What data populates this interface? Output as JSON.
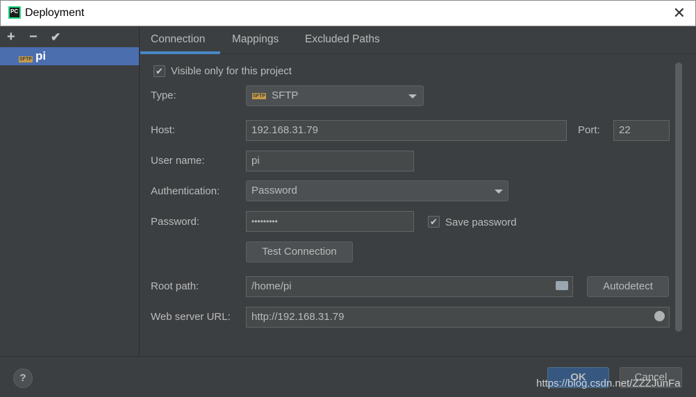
{
  "window": {
    "title": "Deployment",
    "app_icon_text": "PC"
  },
  "left_panel": {
    "toolbar": {
      "add": "+",
      "remove": "−",
      "apply": "✔"
    },
    "servers": [
      {
        "name": "pi",
        "type_badge": "SFTP",
        "selected": true
      }
    ]
  },
  "tabs": [
    {
      "label": "Connection",
      "active": true
    },
    {
      "label": "Mappings"
    },
    {
      "label": "Excluded Paths"
    }
  ],
  "form": {
    "visible_only": {
      "label": "Visible only for this project",
      "checked": true
    },
    "type": {
      "label": "Type:",
      "value": "SFTP",
      "badge": "SFTP"
    },
    "host": {
      "label": "Host:",
      "value": "192.168.31.79"
    },
    "port": {
      "label": "Port:",
      "value": "22"
    },
    "user": {
      "label": "User name:",
      "value": "pi"
    },
    "auth": {
      "label": "Authentication:",
      "value": "Password"
    },
    "password": {
      "label": "Password:",
      "value": "•••••••••"
    },
    "save_password": {
      "label": "Save password",
      "checked": true
    },
    "test_connection": "Test Connection",
    "root_path": {
      "label": "Root path:",
      "value": "/home/pi"
    },
    "autodetect": "Autodetect",
    "web_url": {
      "label": "Web server URL:",
      "value": "http://192.168.31.79"
    }
  },
  "footer": {
    "help": "?",
    "ok": "OK",
    "cancel": "Cancel"
  },
  "watermark": "https://blog.csdn.net/ZZZJunFa",
  "colors": {
    "accent": "#4a88c7",
    "selection": "#4b6eaf",
    "background": "#3c3f41"
  }
}
